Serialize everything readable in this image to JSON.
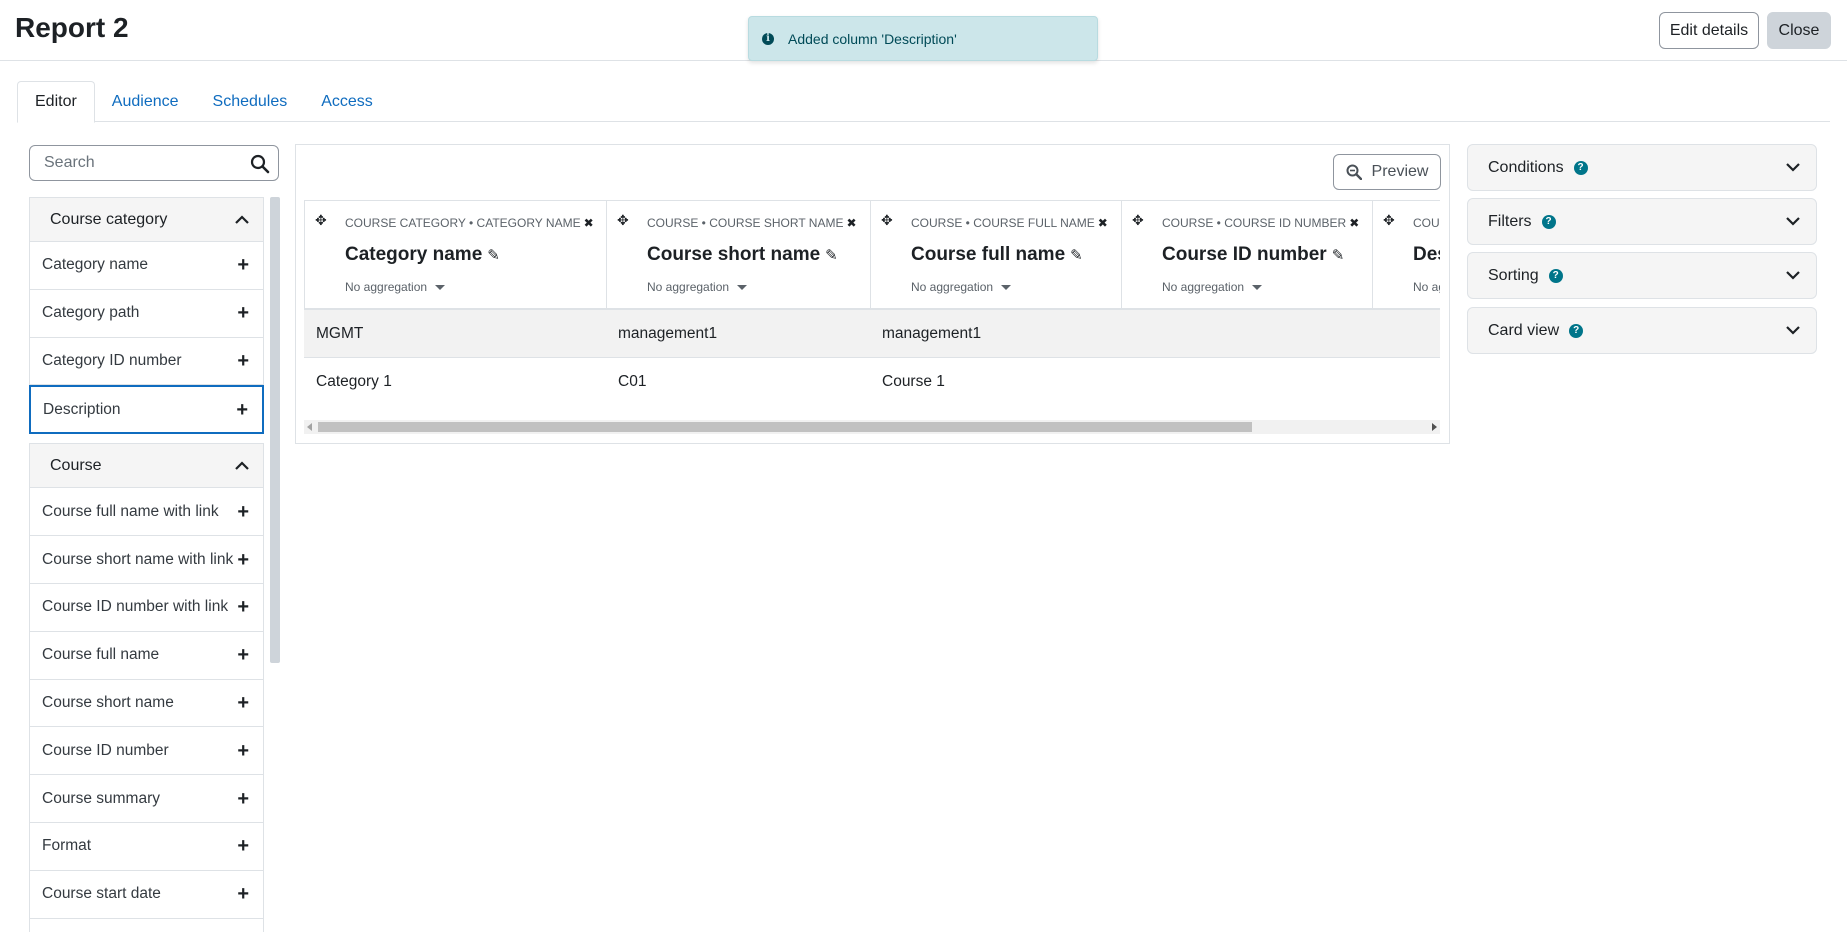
{
  "header": {
    "title": "Report 2",
    "edit_details_label": "Edit details",
    "close_label": "Close"
  },
  "toast": {
    "message": "Added column 'Description'"
  },
  "tabs": [
    {
      "label": "Editor",
      "active": true
    },
    {
      "label": "Audience",
      "active": false
    },
    {
      "label": "Schedules",
      "active": false
    },
    {
      "label": "Access",
      "active": false
    }
  ],
  "sidebar": {
    "search_placeholder": "Search",
    "category1": {
      "title": "Course category",
      "items": [
        "Category name",
        "Category path",
        "Category ID number",
        "Description"
      ]
    },
    "category2": {
      "title": "Course",
      "items": [
        "Course full name with link",
        "Course short name with link",
        "Course ID number with link",
        "Course full name",
        "Course short name",
        "Course ID number",
        "Course summary",
        "Format",
        "Course start date"
      ]
    }
  },
  "table": {
    "preview_label": "Preview",
    "columns": [
      {
        "path": "Course category • Category name",
        "name": "Category name",
        "aggregation": "No aggregation"
      },
      {
        "path": "Course • Course short name",
        "name": "Course short name",
        "aggregation": "No aggregation"
      },
      {
        "path": "Course • Course full name",
        "name": "Course full name",
        "aggregation": "No aggregation"
      },
      {
        "path": "Course • Course ID number",
        "name": "Course ID number",
        "aggregation": "No aggregation"
      },
      {
        "path": "Course category • Description",
        "name": "Description",
        "aggregation": "No aggregation"
      }
    ],
    "rows": [
      [
        "MGMT",
        "management1",
        "management1",
        "",
        ""
      ],
      [
        "Category 1",
        "C01",
        "Course 1",
        "",
        ""
      ]
    ]
  },
  "panels": {
    "conditions": "Conditions",
    "filters": "Filters",
    "sorting": "Sorting",
    "card_view": "Card view"
  },
  "colors": {
    "accent": "#0f6cbf",
    "toast_bg": "#cce6ea",
    "help_icon": "#00758a"
  }
}
